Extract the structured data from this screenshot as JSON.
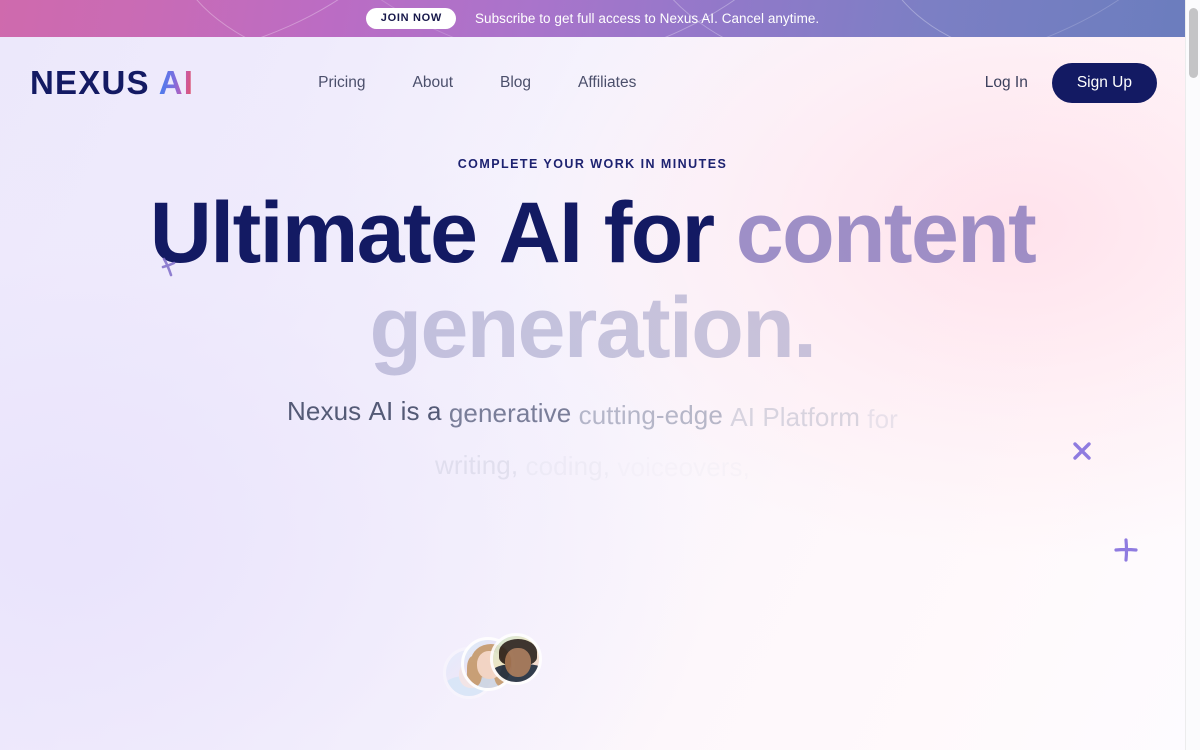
{
  "promo": {
    "cta_label": "JOIN NOW",
    "message": "Subscribe to get full access to Nexus AI. Cancel anytime.",
    "gradient_from": "#cf6aad",
    "gradient_to": "#6b7dbe"
  },
  "nav": {
    "logo": {
      "primary": "NEXUS",
      "accent": "AI",
      "accent_gradient_from": "#3f7ff0",
      "accent_gradient_to": "#e8554f",
      "primary_color": "#131a63"
    },
    "links": [
      {
        "label": "Pricing"
      },
      {
        "label": "About"
      },
      {
        "label": "Blog"
      },
      {
        "label": "Affiliates"
      }
    ],
    "login_label": "Log In",
    "signup_label": "Sign Up",
    "signup_bg": "#131a63"
  },
  "hero": {
    "eyebrow": "COMPLETE YOUR WORK IN MINUTES",
    "headline_words": [
      {
        "text": "Ultimate",
        "state": "on"
      },
      {
        "text": "AI",
        "state": "on"
      },
      {
        "text": "for",
        "state": "on"
      },
      {
        "text": "content",
        "state": "f1"
      },
      {
        "text": "generation.",
        "state": "f2"
      }
    ],
    "subheadline_words": [
      {
        "text": "Nexus",
        "state": "on"
      },
      {
        "text": "AI",
        "state": "on"
      },
      {
        "text": "is",
        "state": "on"
      },
      {
        "text": "a",
        "state": "on"
      },
      {
        "text": "generative",
        "state": "d1"
      },
      {
        "text": "cutting-edge",
        "state": "d2"
      },
      {
        "text": "AI",
        "state": "d3"
      },
      {
        "text": "Platform",
        "state": "d3"
      },
      {
        "text": "for",
        "state": "d4"
      },
      {
        "text": "writing,",
        "state": "d4"
      },
      {
        "text": "coding,",
        "state": "d5"
      },
      {
        "text": "voiceovers,",
        "state": "d6"
      }
    ],
    "headline_color": "#131a63",
    "accent_color": "#8a7bbd"
  },
  "decorations": {
    "sparkle_color": "#8f7be0",
    "avatar_count": 3
  },
  "background": {
    "left_tint": "#ece8fb",
    "right_tint": "#fff1f5",
    "base": "#fdfbff"
  },
  "scrollbar": {
    "thumb_color": "#c4c4c6",
    "track_color": "#fbfbfd"
  }
}
